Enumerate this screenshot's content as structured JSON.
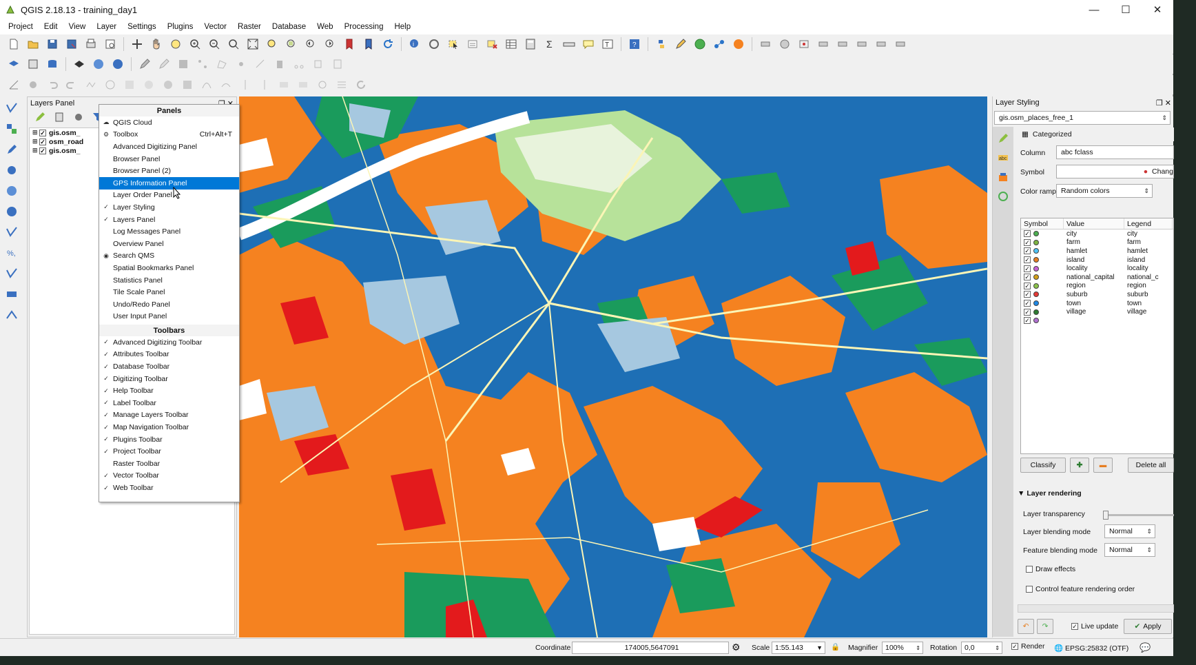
{
  "window": {
    "title": "QGIS 2.18.13 - training_day1"
  },
  "menu": [
    "Project",
    "Edit",
    "View",
    "Layer",
    "Settings",
    "Plugins",
    "Vector",
    "Raster",
    "Database",
    "Web",
    "Processing",
    "Help"
  ],
  "layers_panel": {
    "title": "Layers Panel",
    "layers": [
      {
        "name": "gis.osm_"
      },
      {
        "name": "osm_road"
      },
      {
        "name": "gis.osm_"
      }
    ]
  },
  "context_menu": {
    "panels_header": "Panels",
    "panels": [
      {
        "label": "QGIS Cloud",
        "checked": ""
      },
      {
        "label": "Toolbox",
        "checked": "",
        "shortcut": "Ctrl+Alt+T"
      },
      {
        "label": "Advanced Digitizing Panel",
        "checked": ""
      },
      {
        "label": "Browser Panel",
        "checked": ""
      },
      {
        "label": "Browser Panel (2)",
        "checked": ""
      },
      {
        "label": "GPS Information Panel",
        "checked": "",
        "highlighted": true
      },
      {
        "label": "Layer Order Panel",
        "checked": ""
      },
      {
        "label": "Layer Styling",
        "checked": "✓"
      },
      {
        "label": "Layers Panel",
        "checked": "✓"
      },
      {
        "label": "Log Messages Panel",
        "checked": ""
      },
      {
        "label": "Overview Panel",
        "checked": ""
      },
      {
        "label": "Search QMS",
        "checked": ""
      },
      {
        "label": "Spatial Bookmarks Panel",
        "checked": ""
      },
      {
        "label": "Statistics Panel",
        "checked": ""
      },
      {
        "label": "Tile Scale Panel",
        "checked": ""
      },
      {
        "label": "Undo/Redo Panel",
        "checked": ""
      },
      {
        "label": "User Input Panel",
        "checked": ""
      }
    ],
    "toolbars_header": "Toolbars",
    "toolbars": [
      {
        "label": "Advanced Digitizing Toolbar",
        "checked": "✓"
      },
      {
        "label": "Attributes Toolbar",
        "checked": "✓"
      },
      {
        "label": "Database Toolbar",
        "checked": "✓"
      },
      {
        "label": "Digitizing Toolbar",
        "checked": "✓"
      },
      {
        "label": "Help Toolbar",
        "checked": "✓"
      },
      {
        "label": "Label Toolbar",
        "checked": "✓"
      },
      {
        "label": "Manage Layers Toolbar",
        "checked": "✓"
      },
      {
        "label": "Map Navigation Toolbar",
        "checked": "✓"
      },
      {
        "label": "Plugins Toolbar",
        "checked": "✓"
      },
      {
        "label": "Project Toolbar",
        "checked": "✓"
      },
      {
        "label": "Raster Toolbar",
        "checked": ""
      },
      {
        "label": "Vector Toolbar",
        "checked": "✓"
      },
      {
        "label": "Web Toolbar",
        "checked": "✓"
      }
    ]
  },
  "styling": {
    "title": "Layer Styling",
    "layer": "gis.osm_places_free_1",
    "renderer": "Categorized",
    "column_label": "Column",
    "column_value": "abc fclass",
    "symbol_label": "Symbol",
    "symbol_button": "Chang",
    "ramp_label": "Color ramp",
    "ramp_value": "Random colors",
    "table_headers": [
      "Symbol",
      "Value",
      "Legend"
    ],
    "categories": [
      {
        "value": "city",
        "legend": "city",
        "color": "#4caf50"
      },
      {
        "value": "farm",
        "legend": "farm",
        "color": "#7cb342"
      },
      {
        "value": "hamlet",
        "legend": "hamlet",
        "color": "#4fc3f7"
      },
      {
        "value": "island",
        "legend": "island",
        "color": "#e67e22"
      },
      {
        "value": "locality",
        "legend": "locality",
        "color": "#c662d6"
      },
      {
        "value": "national_capital",
        "legend": "national_c",
        "color": "#d4a017"
      },
      {
        "value": "region",
        "legend": "region",
        "color": "#8bc34a"
      },
      {
        "value": "suburb",
        "legend": "suburb",
        "color": "#e53935"
      },
      {
        "value": "town",
        "legend": "town",
        "color": "#1e88e5"
      },
      {
        "value": "village",
        "legend": "village",
        "color": "#2e7d32"
      },
      {
        "value": "",
        "legend": "",
        "color": "#b070d0"
      }
    ],
    "classify": "Classify",
    "delete_all": "Delete all",
    "rendering_header": "Layer rendering",
    "transparency": "Layer transparency",
    "blend_layer": "Layer blending mode",
    "blend_layer_value": "Normal",
    "blend_feature": "Feature blending mode",
    "blend_feature_value": "Normal",
    "draw_effects": "Draw effects",
    "control_order": "Control feature rendering order",
    "live_update": "Live update",
    "apply": "Apply"
  },
  "statusbar": {
    "coordinate_label": "Coordinate",
    "coordinate_value": "174005,5647091",
    "scale_label": "Scale",
    "scale_value": "1:55.143",
    "magnifier_label": "Magnifier",
    "magnifier_value": "100%",
    "rotation_label": "Rotation",
    "rotation_value": "0,0",
    "render_label": "Render",
    "crs": "EPSG:25832 (OTF)"
  },
  "colors": {
    "orange": "#f58220",
    "blue": "#1e6fb5",
    "green": "#1a9b5c",
    "red": "#e31a1c",
    "lightblue": "#a6c8e0",
    "lightgreen": "#b7e29a"
  }
}
